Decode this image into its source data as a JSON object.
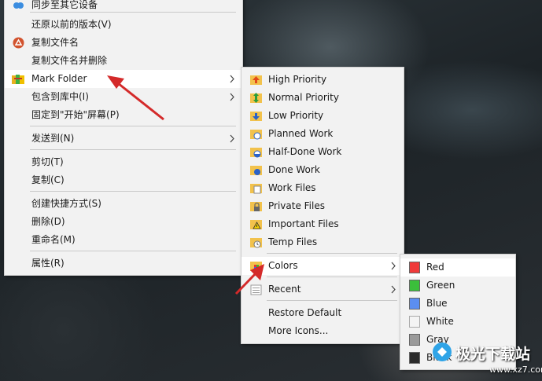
{
  "main_menu": {
    "items": [
      {
        "label": "同步至其它设备"
      },
      {
        "label": "还原以前的版本(V)"
      },
      {
        "label": "复制文件名"
      },
      {
        "label": "复制文件名并删除"
      },
      {
        "label": "Mark Folder"
      },
      {
        "label": "包含到库中(I)"
      },
      {
        "label": "固定到\"开始\"屏幕(P)"
      },
      {
        "label": "发送到(N)"
      },
      {
        "label": "剪切(T)"
      },
      {
        "label": "复制(C)"
      },
      {
        "label": "创建快捷方式(S)"
      },
      {
        "label": "删除(D)"
      },
      {
        "label": "重命名(M)"
      },
      {
        "label": "属性(R)"
      }
    ]
  },
  "mark_folder_menu": {
    "items": [
      {
        "label": "High Priority"
      },
      {
        "label": "Normal Priority"
      },
      {
        "label": "Low Priority"
      },
      {
        "label": "Planned Work"
      },
      {
        "label": "Half-Done Work"
      },
      {
        "label": "Done Work"
      },
      {
        "label": "Work Files"
      },
      {
        "label": "Private Files"
      },
      {
        "label": "Important Files"
      },
      {
        "label": "Temp Files"
      },
      {
        "label": "Colors"
      },
      {
        "label": "Recent"
      },
      {
        "label": "Restore Default"
      },
      {
        "label": "More Icons..."
      }
    ]
  },
  "colors_menu": {
    "items": [
      {
        "label": "Red",
        "swatch": "#f03a3a"
      },
      {
        "label": "Green",
        "swatch": "#3bbf3b"
      },
      {
        "label": "Blue",
        "swatch": "#5b8ef0"
      },
      {
        "label": "White",
        "swatch": "#f4f4f4"
      },
      {
        "label": "Gray",
        "swatch": "#9a9a9a"
      },
      {
        "label": "Black",
        "swatch": "#2b2b2b"
      }
    ]
  },
  "watermark": {
    "brand": "极光下载站",
    "url": "www.xz7.com"
  },
  "colors": {
    "highlight": "#ffffff",
    "menu_bg": "#f2f2f2",
    "arrow": "#d42a2a"
  }
}
